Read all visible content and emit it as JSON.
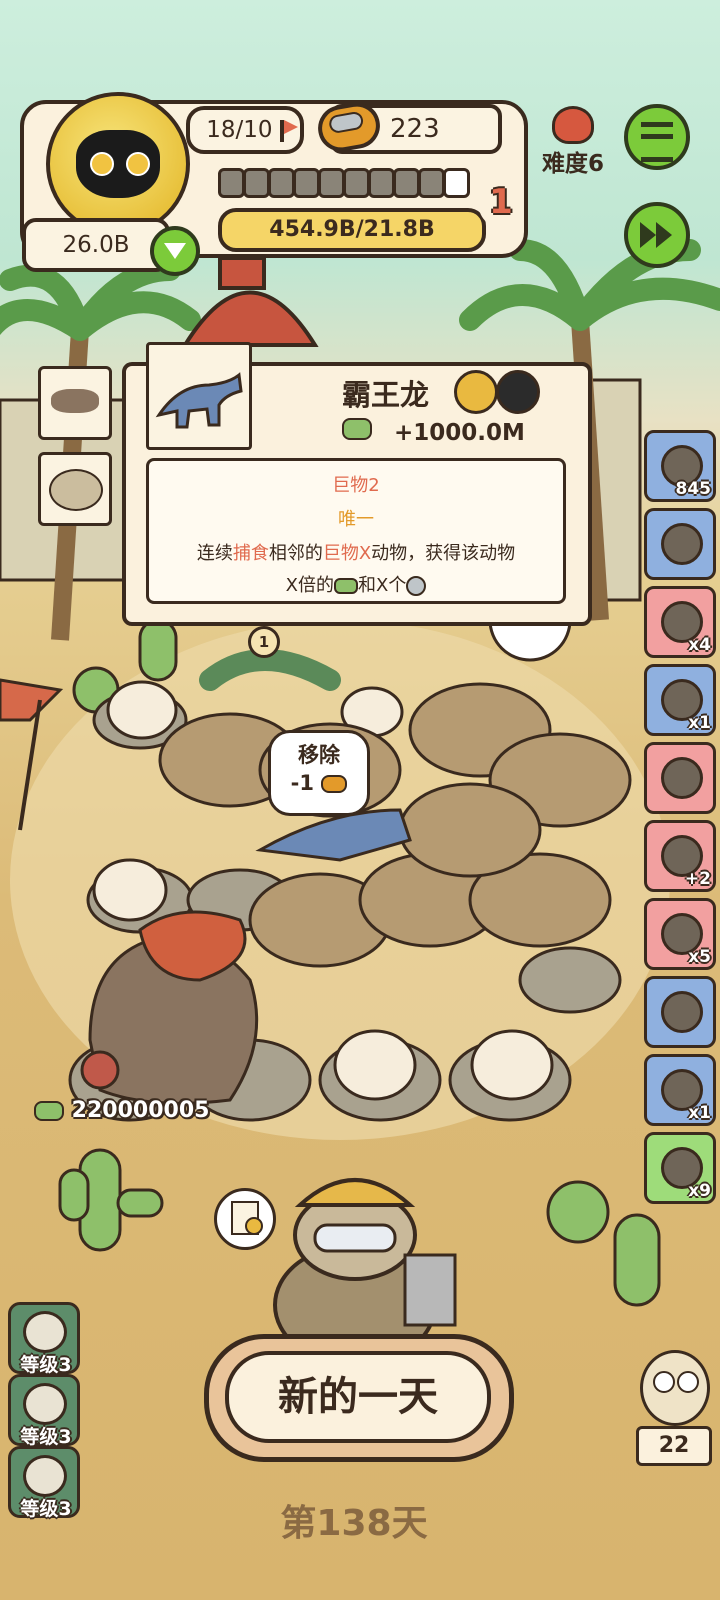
{
  "hud": {
    "population": "18/10",
    "cans": "223",
    "difficulty": "难度6",
    "progress_value": "454.9B/21.8B",
    "progress_level": "1",
    "progress_segments_filled": 10,
    "coins": "26.0B"
  },
  "tooltip": {
    "animal_name": "霸王龙",
    "reward": "+1000.0M",
    "trait_name": "巨物2",
    "trait_tag": "唯一",
    "desc_parts": [
      "连续",
      "捕食",
      "相邻的",
      "巨物X",
      "动物，获得该动物",
      "X倍的",
      "和X个"
    ]
  },
  "board": {
    "remove_label": "移除",
    "remove_cost": "-1",
    "food_count": "220000005",
    "slot_marker": "1"
  },
  "right_items": [
    {
      "icon": "film-reel-icon",
      "count": "845",
      "color": "#8fb0df"
    },
    {
      "icon": "frame-loom-icon",
      "count": "",
      "color": "#8fb0df"
    },
    {
      "icon": "bomb-icon",
      "count": "x4",
      "color": "#f2a0a0"
    },
    {
      "icon": "axe-icon",
      "count": "x1",
      "color": "#8fb0df"
    },
    {
      "icon": "hanging-meat-icon",
      "count": "",
      "color": "#f2a0a0"
    },
    {
      "icon": "paw-coin-icon",
      "count": "+2",
      "color": "#f2a0a0"
    },
    {
      "icon": "trap-plate-icon",
      "count": "x5",
      "color": "#f2a0a0"
    },
    {
      "icon": "hut-icon",
      "count": "",
      "color": "#8fb0df"
    },
    {
      "icon": "scale-icon",
      "count": "x1",
      "color": "#8fb0df"
    },
    {
      "icon": "green-sack-icon",
      "count": "x9",
      "color": "#9edc7a"
    }
  ],
  "left_levels": [
    {
      "icon": "cat-face-icon",
      "label": "等级3"
    },
    {
      "icon": "dino-head-icon",
      "label": "等级3"
    },
    {
      "icon": "paw-badge-icon",
      "label": "等级3"
    }
  ],
  "new_day_button": "新的一天",
  "day_label": "第138天",
  "owl_counter": "22",
  "colors": {
    "accent_red": "#e06a4e",
    "accent_orange": "#e39a2a",
    "button_green": "#7ccb3a"
  }
}
